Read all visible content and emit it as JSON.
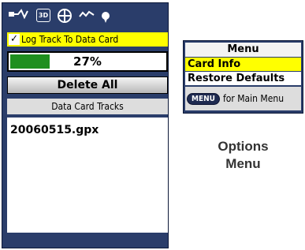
{
  "track_log": {
    "toolbar_icons": [
      "track-log-icon",
      "3d-map-icon",
      "compass-icon",
      "elevation-icon",
      "waypoint-icon"
    ],
    "toolbar_3d_label": "3D",
    "log_checkbox": {
      "checked": true,
      "label": "Log Track To Data Card"
    },
    "progress": {
      "value_percent": 27,
      "label": "27%"
    },
    "delete_button": "Delete All",
    "tracks_header": "Data Card Tracks",
    "tracks": [
      "20060515.gpx"
    ]
  },
  "options_menu": {
    "title": "Menu",
    "items": [
      {
        "label": "Card Info",
        "selected": true
      },
      {
        "label": "Restore Defaults",
        "selected": false
      }
    ],
    "footer_key": "MENU",
    "footer_text": "for Main Menu"
  },
  "caption": {
    "line1": "Options",
    "line2": "Menu"
  },
  "colors": {
    "screen_bg": "#2a3d6a",
    "highlight": "#ffff00",
    "progress_fill": "#1f8f1f"
  }
}
